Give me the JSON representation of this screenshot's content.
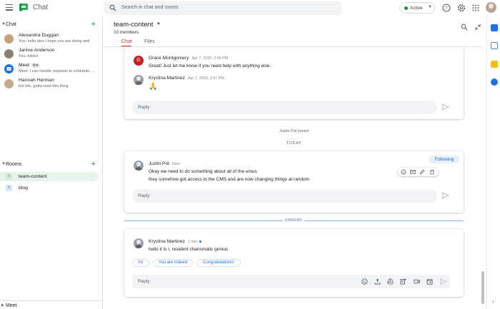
{
  "app": {
    "title": "Chat"
  },
  "search": {
    "placeholder": "Search in chat and rooms"
  },
  "status": {
    "label": "Active"
  },
  "sidebar": {
    "chat_section": "Chat",
    "dms": [
      {
        "name": "Alexandra Duggan",
        "preview": "You: hello alex i hope you are doing well"
      },
      {
        "name": "Janine Anderson",
        "preview": "You: lololol"
      },
      {
        "name": "Meet",
        "badge": "Bot",
        "preview": "Meet: I can handle requests to schedule, ..."
      },
      {
        "name": "Hannah Herman",
        "preview": "but brb, gotta read this thing"
      }
    ],
    "rooms_section": "Rooms",
    "rooms": [
      {
        "name": "team-content",
        "letter": "t"
      },
      {
        "name": "blog",
        "letter": "b"
      }
    ],
    "meet_section": "Meet"
  },
  "room": {
    "title": "team-content",
    "members": "10 members",
    "tabs": [
      "Chat",
      "Files"
    ]
  },
  "thread1": {
    "messages": [
      {
        "author": "Grace Montgomery",
        "time": "Apr 7, 2020, 2:06 PM",
        "text": "Great! Just let me know if you need help with anything else.",
        "avatar_letter": "G"
      },
      {
        "author": "Krystina Martinez",
        "time": "Apr 7, 2020, 2:07 PM",
        "text": "🙏"
      }
    ],
    "reply_placeholder": "Reply"
  },
  "system": {
    "joined": "Justin Pot joined",
    "today": "TODAY",
    "unread": "UNREAD"
  },
  "thread2": {
    "author": "Justin Pot",
    "time": "Now",
    "following": "Following",
    "lines": [
      "Okay we need to do something about all of the emus",
      "they somehow got access to the CMS and are now changing things at random"
    ],
    "reply_placeholder": "Reply"
  },
  "thread3": {
    "author": "Krystina Martinez",
    "time": "1 min",
    "text": "hello it is I, resident charismatic genius",
    "chips": [
      "lol",
      "You are indeed",
      "Congratulations!"
    ],
    "reply_placeholder": "Reply"
  },
  "colors": {
    "accent": "#1a73e8",
    "brand_green": "#1e8e3e",
    "active_tab": "#d93025"
  }
}
